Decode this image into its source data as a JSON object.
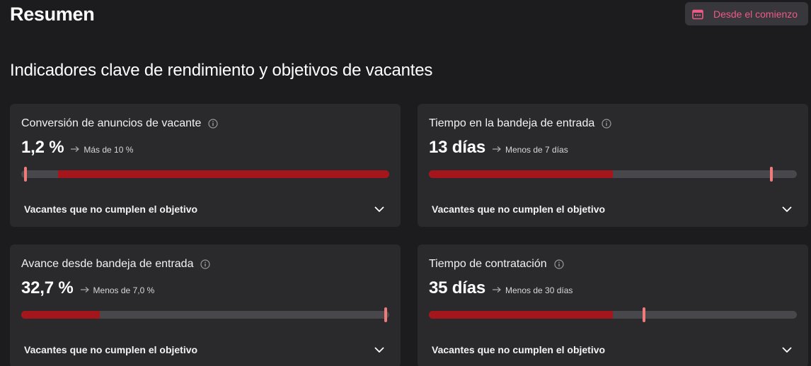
{
  "header": {
    "title": "Resumen",
    "date_filter": {
      "label": "Desde el comienzo",
      "icon": "calendar-icon",
      "accent_color": "#ec5a86"
    }
  },
  "section": {
    "title": "Indicadores clave de rendimiento y objetivos de vacantes"
  },
  "colors": {
    "bar_fill": "#a5161c",
    "bar_track": "#48484c",
    "marker": "#f07b7b"
  },
  "kpis": [
    {
      "title": "Conversión de anuncios de vacante",
      "value": "1,2 %",
      "target": "Más de 10 %",
      "footer": "Vacantes que no cumplen el objetivo",
      "fill_from_pct": 10,
      "fill_to_pct": 100,
      "marker_pct": 1.2
    },
    {
      "title": "Tiempo en la bandeja de entrada",
      "value": "13 días",
      "target": "Menos de 7 días",
      "footer": "Vacantes que no cumplen el objetivo",
      "fill_from_pct": 0,
      "fill_to_pct": 50,
      "marker_pct": 93
    },
    {
      "title": "Avance desde bandeja de entrada",
      "value": "32,7 %",
      "target": "Menos de 7,0 %",
      "footer": "Vacantes que no cumplen el objetivo",
      "fill_from_pct": 0,
      "fill_to_pct": 21.4,
      "marker_pct": 99
    },
    {
      "title": "Tiempo de contratación",
      "value": "35 días",
      "target": "Menos de 30 días",
      "footer": "Vacantes que no cumplen el objetivo",
      "fill_from_pct": 0,
      "fill_to_pct": 50,
      "marker_pct": 58.5
    }
  ]
}
